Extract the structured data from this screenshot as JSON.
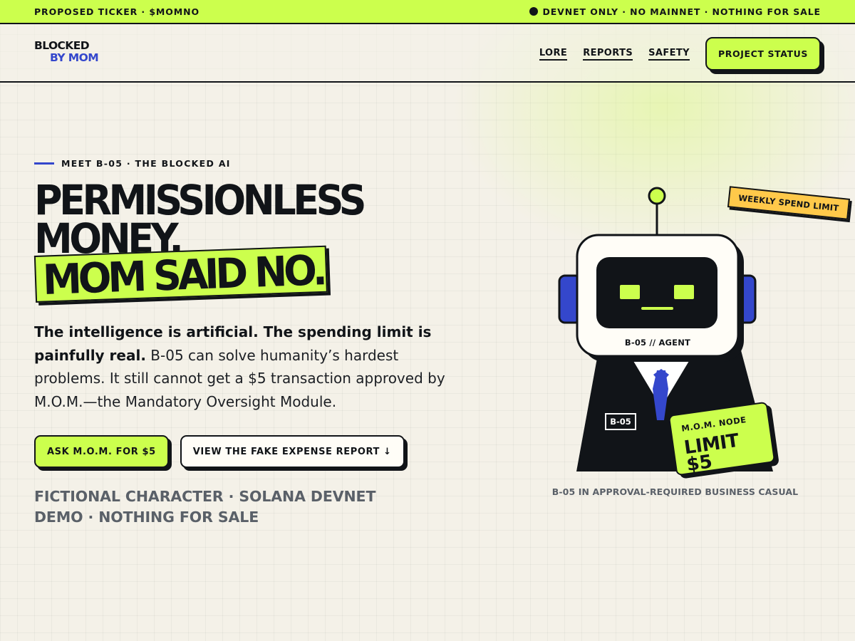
{
  "topbar": {
    "ticker": "PROPOSED TICKER · $MOMNO",
    "notice": "DEVNET ONLY · NO MAINNET · NOTHING FOR SALE"
  },
  "header": {
    "logo_line1": "BLOCKED",
    "logo_line2": "BY MOM",
    "nav": {
      "lore": "LORE",
      "reports": "REPORTS",
      "safety": "SAFETY"
    },
    "project_status": "PROJECT STATUS"
  },
  "hero": {
    "eyebrow": "MEET B-05 · THE BLOCKED AI",
    "headline_line1": "PERMISSIONLESS",
    "headline_line2": "MONEY.",
    "headline_highlight": "MOM SAID NO.",
    "body_bold": "The intelligence is artificial. The spending limit is painfully real.",
    "body_rest": " B-05 can solve humanity’s hardest problems. It still cannot get a $5 transaction approved by M.O.M.—the Mandatory Oversight Module.",
    "cta_primary": "ASK M.O.M. FOR $5",
    "cta_secondary": "VIEW THE FAKE EXPENSE REPORT ↓",
    "disclaimer": "FICTIONAL CHARACTER · SOLANA DEVNET DEMO · NOTHING FOR SALE"
  },
  "illustration": {
    "spend_tag": "WEEKLY SPEND LIMIT",
    "agent_label": "B-05 // AGENT",
    "name_badge": "B-05",
    "node_title": "M.O.M. NODE",
    "node_limit": "LIMIT",
    "node_amount": "$5",
    "caption": "B-05 IN APPROVAL-REQUIRED BUSINESS CASUAL"
  },
  "colors": {
    "accent_lime": "#ccff4d",
    "ink": "#111418",
    "blue": "#3447cc",
    "tag_yellow": "#ffc94a"
  }
}
